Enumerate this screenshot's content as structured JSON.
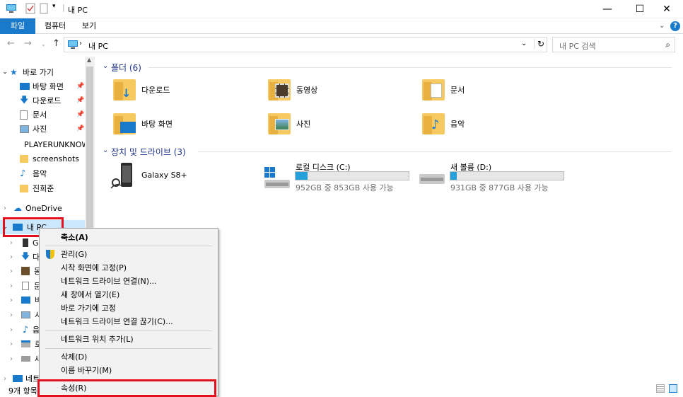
{
  "window": {
    "title": "내 PC",
    "minimize": "—",
    "maximize": "☐",
    "close": "✕"
  },
  "ribbon": {
    "tabs": [
      "파일",
      "컴퓨터",
      "보기"
    ],
    "help": "?"
  },
  "address": {
    "path": "내 PC"
  },
  "search": {
    "placeholder": "내 PC 검색"
  },
  "nav": {
    "quick_access": "바로 가기",
    "items": [
      "바탕 화면",
      "다운로드",
      "문서",
      "사진",
      "PLAYERUNKNOWN",
      "screenshots",
      "음악",
      "진희준"
    ],
    "onedrive": "OneDrive",
    "thispc": "내 PC",
    "sub_items": [
      "Ga",
      "다",
      "동",
      "문",
      "바",
      "사",
      "음",
      "로",
      "새"
    ],
    "network": "네트"
  },
  "main": {
    "folders_header": "폴더 (6)",
    "folders": [
      "다운로드",
      "동영상",
      "문서",
      "바탕 화면",
      "사진",
      "음악"
    ],
    "devices_header": "장치 및 드라이브 (3)",
    "devices": [
      {
        "name": "Galaxy S8+"
      },
      {
        "name": "로컬 디스크 (C:)",
        "info": "952GB 중 853GB 사용 가능",
        "used": 0.104
      },
      {
        "name": "새 볼륨 (D:)",
        "info": "931GB 중 877GB 사용 가능",
        "used": 0.058
      }
    ]
  },
  "status": {
    "count": "9개 항목"
  },
  "context_menu": {
    "items": [
      "축소(A)",
      "관리(G)",
      "시작 화면에 고정(P)",
      "네트워크 드라이브 연결(N)...",
      "새 창에서 열기(E)",
      "바로 가기에 고정",
      "네트워크 드라이브 연결 끊기(C)...",
      "네트워크 위치 추가(L)",
      "삭제(D)",
      "이름 바꾸기(M)",
      "속성(R)"
    ]
  },
  "colors": {
    "accent": "#1979ca",
    "highlight": "#e3101e",
    "bar": "#26a0da",
    "folder": "#f7c961"
  }
}
